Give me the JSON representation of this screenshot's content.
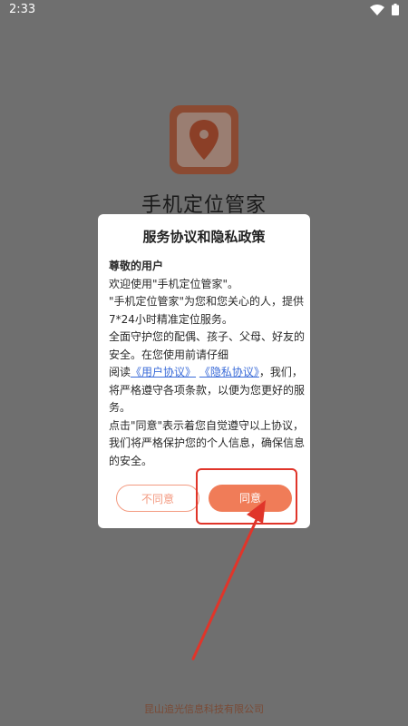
{
  "status_bar": {
    "time": "2:33"
  },
  "app": {
    "name": "手机定位管家",
    "logo_icon": "location-pin-map-icon"
  },
  "dialog": {
    "title": "服务协议和隐私政策",
    "greeting": "尊敬的用户",
    "welcome": "欢迎使用\"手机定位管家\"。",
    "intro": "\"手机定位管家\"为您和您关心的人，提供7*24小时精准定位服务。",
    "protect": "全面守护您的配偶、孩子、父母、好友的安全。在您使用前请仔细",
    "read_prefix": "阅读",
    "user_agreement": "《用户协议》",
    "privacy_agreement": "《隐私协议》",
    "read_suffix": "，我们，将严格遵守各项条款，以便为您更好的服务。",
    "consent": "点击\"同意\"表示着您自觉遵守以上协议，我们将严格保护您的个人信息，确保信息的安全。",
    "disagree_label": "不同意",
    "agree_label": "同意"
  },
  "footer": {
    "company": "昆山追光信息科技有限公司"
  },
  "colors": {
    "accent": "#f07c58",
    "highlight": "#e0352a",
    "link": "#3a6bd8",
    "overlay": "#6f6f6f"
  }
}
